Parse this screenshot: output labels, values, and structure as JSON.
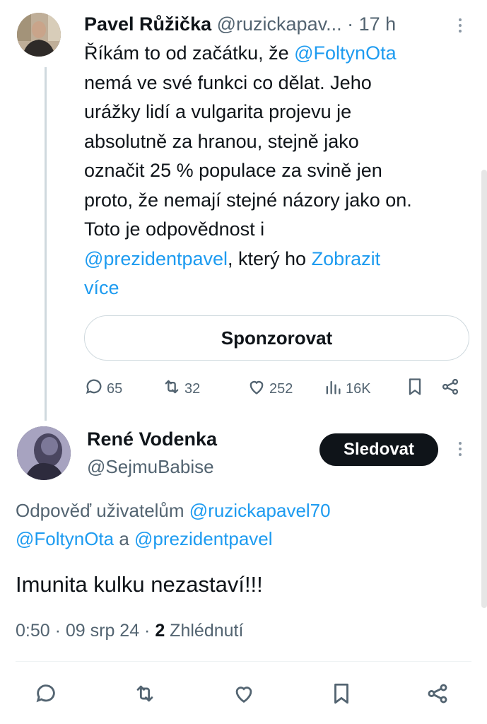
{
  "tweet": {
    "author_name": "Pavel Růžička",
    "author_handle": "@ruzickapav...",
    "time": "· 17 h",
    "text_lines": [
      [
        {
          "t": "Říkám to od začátku, že "
        },
        {
          "t": "@FoltynOta",
          "link": true
        }
      ],
      [
        {
          "t": "nemá ve své funkci co dělat. Jeho"
        }
      ],
      [
        {
          "t": "urážky lidí a vulgarita projevu je"
        }
      ],
      [
        {
          "t": "absolutně za hranou, stejně jako"
        }
      ],
      [
        {
          "t": "označit 25 % populace za svině jen"
        }
      ],
      [
        {
          "t": "proto, že nemají stejné názory jako on."
        }
      ],
      [
        {
          "t": "Toto je odpovědnost i"
        }
      ],
      [
        {
          "t": "@prezidentpavel",
          "link": true
        },
        {
          "t": ", který ho "
        },
        {
          "t": "Zobrazit",
          "link": true
        }
      ],
      [
        {
          "t": "více",
          "link": true
        }
      ]
    ],
    "sponsor_label": "Sponzorovat",
    "stats": {
      "replies": "65",
      "retweets": "32",
      "likes": "252",
      "views": "16K"
    }
  },
  "reply": {
    "author_name": "René Vodenka",
    "author_handle": "@SejmuBabise",
    "follow_label": "Sledovat",
    "reply_to_prefix": "Odpověď uživatelům ",
    "reply_to_user1": "@ruzickapavel70",
    "reply_to_user2": "@FoltynOta",
    "reply_to_joiner": " a ",
    "reply_to_user3": "@prezidentpavel",
    "text": "Imunita kulku nezastaví!!!",
    "time": "0:50 · 09 srp 24 · ",
    "views_count": "2",
    "views_label": " Zhlédnutí"
  },
  "icons": {
    "reply": "speech-bubble-icon",
    "retweet": "retweet-icon",
    "like": "heart-icon",
    "views": "bar-chart-icon",
    "bookmark": "bookmark-icon",
    "share": "share-icon",
    "more": "vertical-dots-icon"
  },
  "colors": {
    "accent": "#1d9bf0",
    "text": "#0f1419",
    "muted": "#536471",
    "follow_button_bg": "#0f1419"
  }
}
